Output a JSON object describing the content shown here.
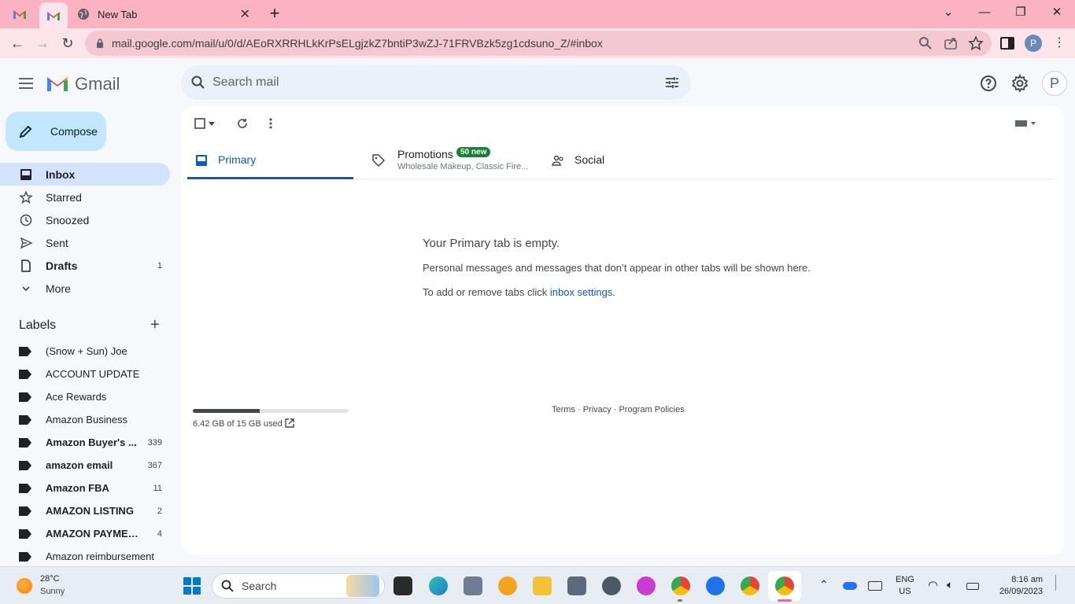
{
  "browser": {
    "tabs": [
      {
        "title": "",
        "icon": "gmail-icon"
      },
      {
        "title": "",
        "icon": "gmail-icon"
      },
      {
        "title": "New Tab",
        "icon": "globe-icon"
      }
    ],
    "url": "mail.google.com/mail/u/0/d/AEoRXRRHLkKrPsELgjzkZ7bntiP3wZJ-71FRVBzk5zg1cdsuno_Z/#inbox",
    "profile_initial": "P",
    "colors": {
      "tabstrip": "#fbb2c2",
      "toolbar": "#fde3ea"
    }
  },
  "gmail": {
    "wordmark": "Gmail",
    "search_placeholder": "Search mail",
    "avatar_initial": "P",
    "compose_label": "Compose",
    "nav": [
      {
        "label": "Inbox",
        "count": "",
        "icon": "inbox-icon",
        "active": true
      },
      {
        "label": "Starred",
        "count": "",
        "icon": "star-icon"
      },
      {
        "label": "Snoozed",
        "count": "",
        "icon": "clock-icon"
      },
      {
        "label": "Sent",
        "count": "",
        "icon": "send-icon"
      },
      {
        "label": "Drafts",
        "count": "1",
        "icon": "draft-icon",
        "bold": true
      },
      {
        "label": "More",
        "count": "",
        "icon": "chevron-down-icon"
      }
    ],
    "labels_heading": "Labels",
    "labels": [
      {
        "name": "(Snow + Sun) Joe",
        "count": ""
      },
      {
        "name": "ACCOUNT UPDATE",
        "count": ""
      },
      {
        "name": "Ace Rewards",
        "count": ""
      },
      {
        "name": "Amazon Business",
        "count": ""
      },
      {
        "name": "Amazon Buyer's ...",
        "count": "339",
        "bold": true
      },
      {
        "name": "amazon email",
        "count": "367",
        "bold": true
      },
      {
        "name": "Amazon FBA",
        "count": "11",
        "bold": true
      },
      {
        "name": "AMAZON LISTING",
        "count": "2",
        "bold": true
      },
      {
        "name": "AMAZON PAYMENT",
        "count": "4",
        "bold": true
      },
      {
        "name": "Amazon reimbursement",
        "count": ""
      }
    ],
    "tabs": {
      "primary": "Primary",
      "promotions": "Promotions",
      "promotions_badge": "50 new",
      "promotions_sub": "Wholesale Makeup, Classic Fire...",
      "social": "Social"
    },
    "empty": {
      "title": "Your Primary tab is empty.",
      "message": "Personal messages and messages that don’t appear in other tabs will be shown here.",
      "settings_prefix": "To add or remove tabs click ",
      "settings_link": "inbox settings",
      "settings_suffix": "."
    },
    "storage": {
      "text": "6.42 GB of 15 GB used",
      "used_fraction": 0.428
    },
    "footer": "Terms · Privacy · Program Policies"
  },
  "taskbar": {
    "temp": "28°C",
    "condition": "Sunny",
    "search_label": "Search",
    "lang1": "ENG",
    "lang2": "US",
    "time": "8:16 am",
    "date": "26/09/2023"
  }
}
